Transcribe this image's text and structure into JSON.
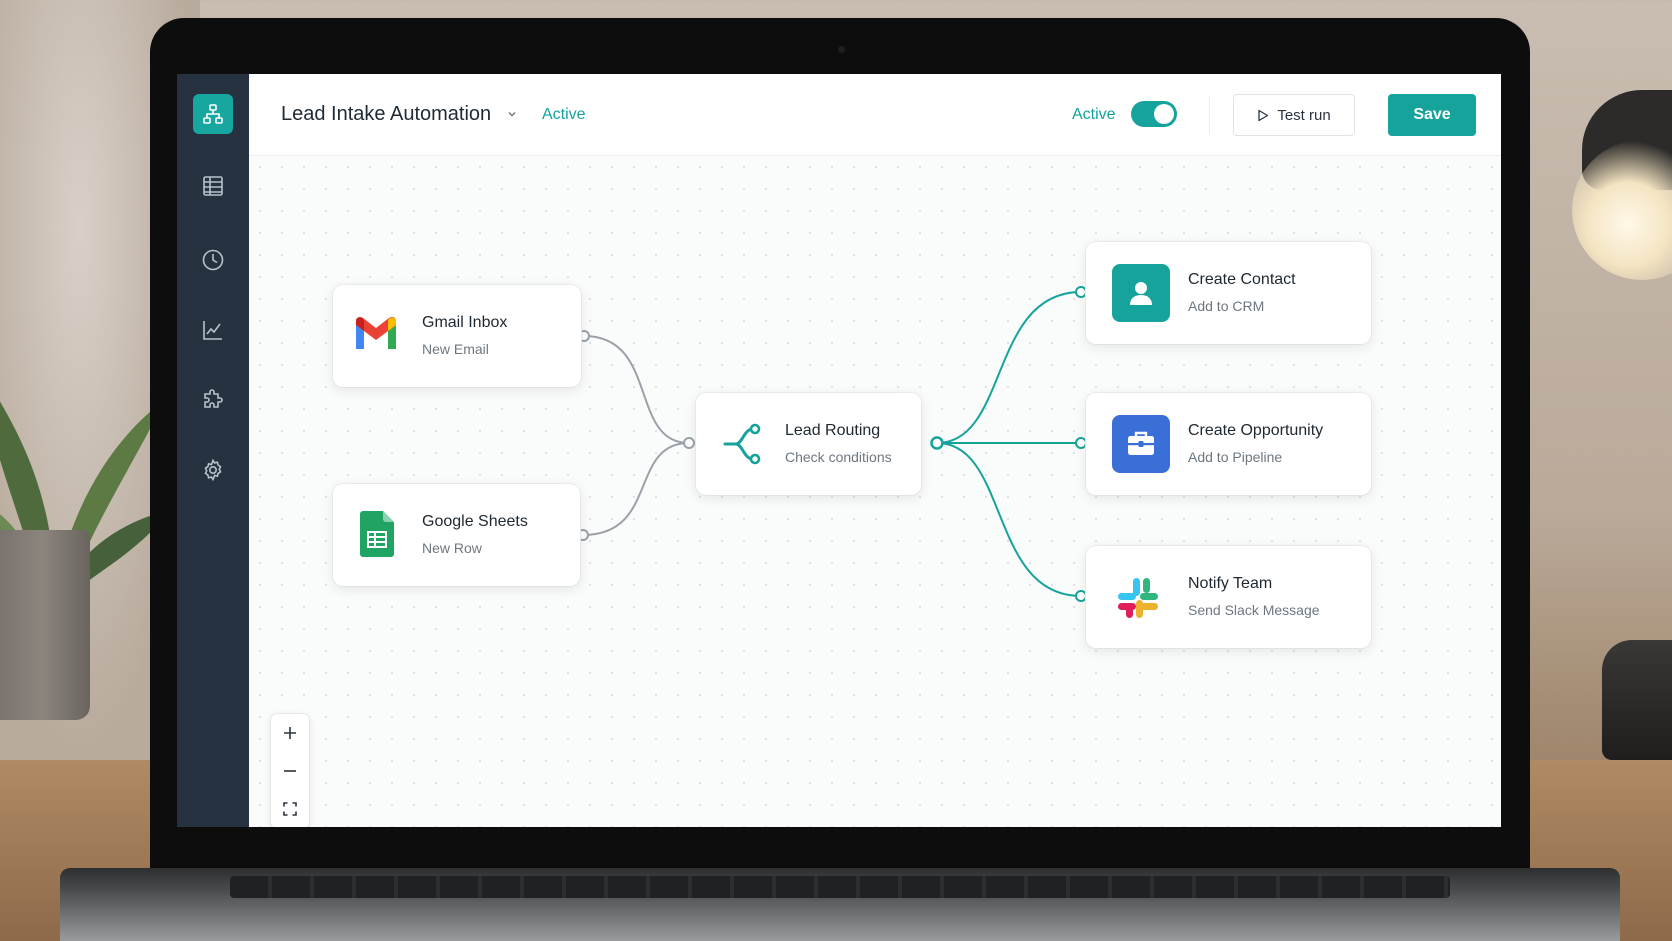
{
  "app": {
    "title": "Lead Intake Automation",
    "status": "Active"
  },
  "header": {
    "toggle_label": "Active",
    "toggle_on": true,
    "test_run_label": "Test run",
    "save_label": "Save"
  },
  "sidebar": {
    "items": [
      {
        "icon": "workflow-icon",
        "active": true
      },
      {
        "icon": "table-icon"
      },
      {
        "icon": "clock-icon"
      },
      {
        "icon": "chart-icon"
      },
      {
        "icon": "puzzle-icon"
      },
      {
        "icon": "gear-icon"
      }
    ]
  },
  "nodes": {
    "gmail": {
      "title": "Gmail Inbox",
      "subtitle": "New Email",
      "icon": "gmail-icon"
    },
    "sheets": {
      "title": "Google Sheets",
      "subtitle": "New Row",
      "icon": "google-sheets-icon"
    },
    "routing": {
      "title": "Lead Routing",
      "subtitle": "Check conditions",
      "icon": "branch-icon"
    },
    "contact": {
      "title": "Create Contact",
      "subtitle": "Add to CRM",
      "icon": "person-icon"
    },
    "opportunity": {
      "title": "Create Opportunity",
      "subtitle": "Add to Pipeline",
      "icon": "briefcase-icon"
    },
    "notify": {
      "title": "Notify Team",
      "subtitle": "Send Slack Message",
      "icon": "slack-icon"
    }
  },
  "zoom_controls": [
    "zoom-in",
    "zoom-out",
    "fit-view"
  ],
  "colors": {
    "accent": "#15a39c",
    "sidebar": "#263240",
    "wire_inactive": "#9aa1a8",
    "crm_tile": "#15a39c",
    "pipeline_tile": "#3b6fd8"
  }
}
